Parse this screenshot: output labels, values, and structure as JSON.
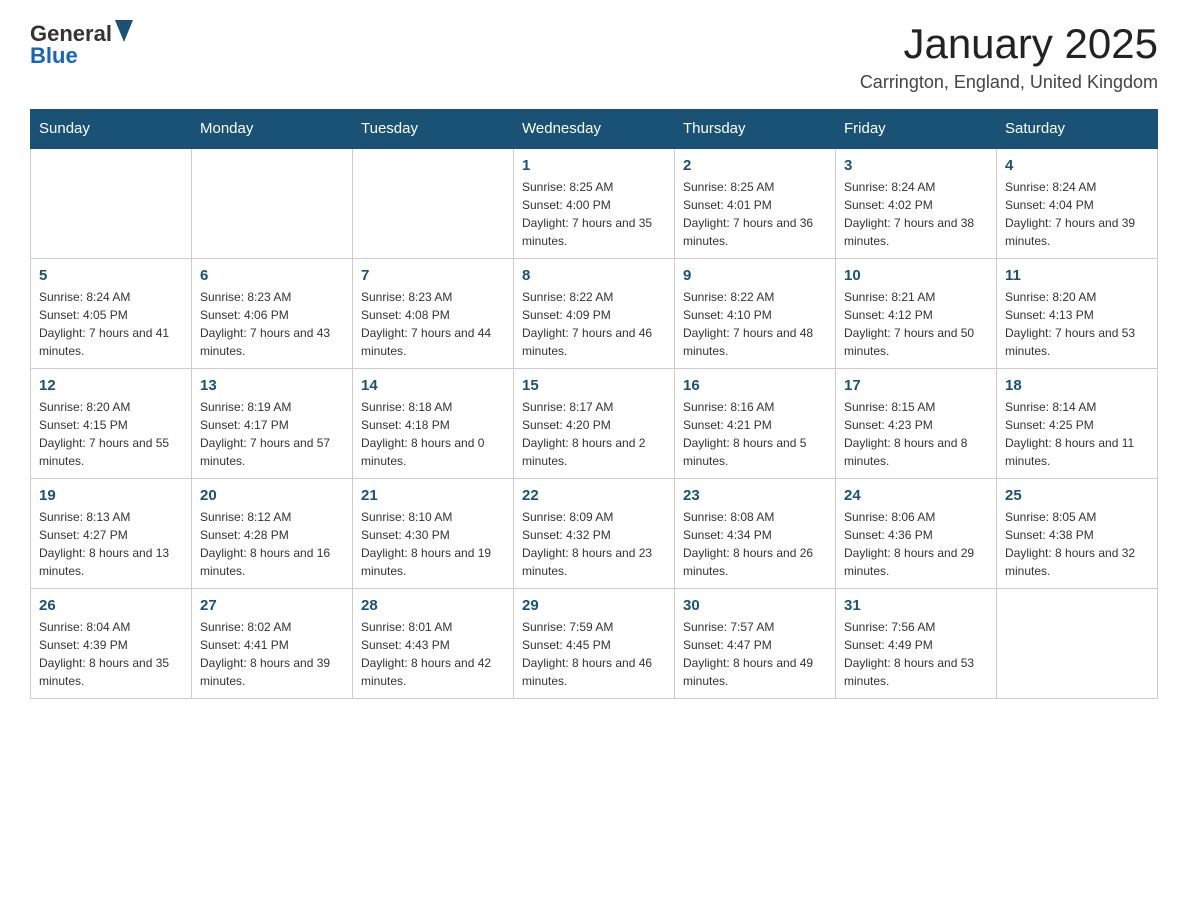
{
  "header": {
    "logo": {
      "general": "General",
      "blue": "Blue"
    },
    "title": "January 2025",
    "subtitle": "Carrington, England, United Kingdom"
  },
  "days_of_week": [
    "Sunday",
    "Monday",
    "Tuesday",
    "Wednesday",
    "Thursday",
    "Friday",
    "Saturday"
  ],
  "weeks": [
    [
      {
        "day": "",
        "info": ""
      },
      {
        "day": "",
        "info": ""
      },
      {
        "day": "",
        "info": ""
      },
      {
        "day": "1",
        "info": "Sunrise: 8:25 AM\nSunset: 4:00 PM\nDaylight: 7 hours and 35 minutes."
      },
      {
        "day": "2",
        "info": "Sunrise: 8:25 AM\nSunset: 4:01 PM\nDaylight: 7 hours and 36 minutes."
      },
      {
        "day": "3",
        "info": "Sunrise: 8:24 AM\nSunset: 4:02 PM\nDaylight: 7 hours and 38 minutes."
      },
      {
        "day": "4",
        "info": "Sunrise: 8:24 AM\nSunset: 4:04 PM\nDaylight: 7 hours and 39 minutes."
      }
    ],
    [
      {
        "day": "5",
        "info": "Sunrise: 8:24 AM\nSunset: 4:05 PM\nDaylight: 7 hours and 41 minutes."
      },
      {
        "day": "6",
        "info": "Sunrise: 8:23 AM\nSunset: 4:06 PM\nDaylight: 7 hours and 43 minutes."
      },
      {
        "day": "7",
        "info": "Sunrise: 8:23 AM\nSunset: 4:08 PM\nDaylight: 7 hours and 44 minutes."
      },
      {
        "day": "8",
        "info": "Sunrise: 8:22 AM\nSunset: 4:09 PM\nDaylight: 7 hours and 46 minutes."
      },
      {
        "day": "9",
        "info": "Sunrise: 8:22 AM\nSunset: 4:10 PM\nDaylight: 7 hours and 48 minutes."
      },
      {
        "day": "10",
        "info": "Sunrise: 8:21 AM\nSunset: 4:12 PM\nDaylight: 7 hours and 50 minutes."
      },
      {
        "day": "11",
        "info": "Sunrise: 8:20 AM\nSunset: 4:13 PM\nDaylight: 7 hours and 53 minutes."
      }
    ],
    [
      {
        "day": "12",
        "info": "Sunrise: 8:20 AM\nSunset: 4:15 PM\nDaylight: 7 hours and 55 minutes."
      },
      {
        "day": "13",
        "info": "Sunrise: 8:19 AM\nSunset: 4:17 PM\nDaylight: 7 hours and 57 minutes."
      },
      {
        "day": "14",
        "info": "Sunrise: 8:18 AM\nSunset: 4:18 PM\nDaylight: 8 hours and 0 minutes."
      },
      {
        "day": "15",
        "info": "Sunrise: 8:17 AM\nSunset: 4:20 PM\nDaylight: 8 hours and 2 minutes."
      },
      {
        "day": "16",
        "info": "Sunrise: 8:16 AM\nSunset: 4:21 PM\nDaylight: 8 hours and 5 minutes."
      },
      {
        "day": "17",
        "info": "Sunrise: 8:15 AM\nSunset: 4:23 PM\nDaylight: 8 hours and 8 minutes."
      },
      {
        "day": "18",
        "info": "Sunrise: 8:14 AM\nSunset: 4:25 PM\nDaylight: 8 hours and 11 minutes."
      }
    ],
    [
      {
        "day": "19",
        "info": "Sunrise: 8:13 AM\nSunset: 4:27 PM\nDaylight: 8 hours and 13 minutes."
      },
      {
        "day": "20",
        "info": "Sunrise: 8:12 AM\nSunset: 4:28 PM\nDaylight: 8 hours and 16 minutes."
      },
      {
        "day": "21",
        "info": "Sunrise: 8:10 AM\nSunset: 4:30 PM\nDaylight: 8 hours and 19 minutes."
      },
      {
        "day": "22",
        "info": "Sunrise: 8:09 AM\nSunset: 4:32 PM\nDaylight: 8 hours and 23 minutes."
      },
      {
        "day": "23",
        "info": "Sunrise: 8:08 AM\nSunset: 4:34 PM\nDaylight: 8 hours and 26 minutes."
      },
      {
        "day": "24",
        "info": "Sunrise: 8:06 AM\nSunset: 4:36 PM\nDaylight: 8 hours and 29 minutes."
      },
      {
        "day": "25",
        "info": "Sunrise: 8:05 AM\nSunset: 4:38 PM\nDaylight: 8 hours and 32 minutes."
      }
    ],
    [
      {
        "day": "26",
        "info": "Sunrise: 8:04 AM\nSunset: 4:39 PM\nDaylight: 8 hours and 35 minutes."
      },
      {
        "day": "27",
        "info": "Sunrise: 8:02 AM\nSunset: 4:41 PM\nDaylight: 8 hours and 39 minutes."
      },
      {
        "day": "28",
        "info": "Sunrise: 8:01 AM\nSunset: 4:43 PM\nDaylight: 8 hours and 42 minutes."
      },
      {
        "day": "29",
        "info": "Sunrise: 7:59 AM\nSunset: 4:45 PM\nDaylight: 8 hours and 46 minutes."
      },
      {
        "day": "30",
        "info": "Sunrise: 7:57 AM\nSunset: 4:47 PM\nDaylight: 8 hours and 49 minutes."
      },
      {
        "day": "31",
        "info": "Sunrise: 7:56 AM\nSunset: 4:49 PM\nDaylight: 8 hours and 53 minutes."
      },
      {
        "day": "",
        "info": ""
      }
    ]
  ]
}
